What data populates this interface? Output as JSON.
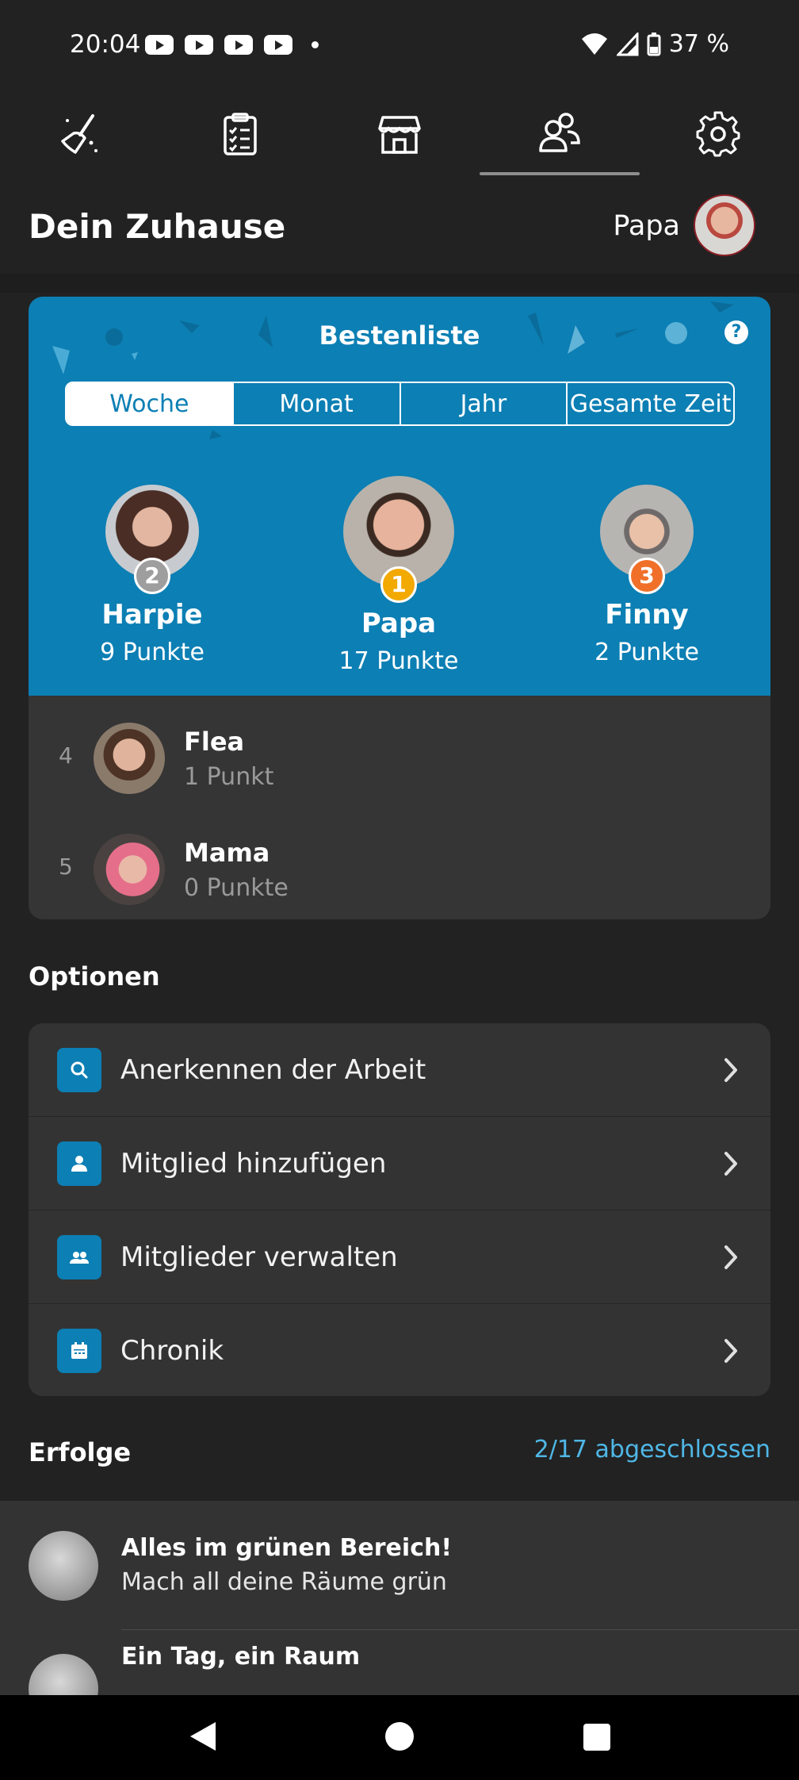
{
  "status_bar": {
    "time": "20:04",
    "battery": "37 %"
  },
  "nav_tabs": [
    {
      "icon": "cleaning-broom-icon"
    },
    {
      "icon": "clipboard-checklist-icon"
    },
    {
      "icon": "shop-icon"
    },
    {
      "icon": "people-icon",
      "active": true
    },
    {
      "icon": "gear-icon"
    }
  ],
  "header": {
    "title": "Dein Zuhause",
    "username": "Papa"
  },
  "leaderboard": {
    "title": "Bestenliste",
    "periods": [
      "Woche",
      "Monat",
      "Jahr",
      "Gesamte Zeit"
    ],
    "active_period": "Woche",
    "podium": [
      {
        "rank": "2",
        "name": "Harpie",
        "points": "9 Punkte",
        "badge_color": "#9e9e9e"
      },
      {
        "rank": "1",
        "name": "Papa",
        "points": "17 Punkte",
        "badge_color": "#f2a900"
      },
      {
        "rank": "3",
        "name": "Finny",
        "points": "2 Punkte",
        "badge_color": "#f0702a"
      }
    ],
    "rows": [
      {
        "rank": "4",
        "name": "Flea",
        "points": "1 Punkt"
      },
      {
        "rank": "5",
        "name": "Mama",
        "points": "0 Punkte"
      }
    ]
  },
  "options": {
    "title": "Optionen",
    "items": [
      {
        "label": "Anerkennen der Arbeit",
        "icon": "search-icon"
      },
      {
        "label": "Mitglied hinzufügen",
        "icon": "person-icon"
      },
      {
        "label": "Mitglieder verwalten",
        "icon": "group-icon"
      },
      {
        "label": "Chronik",
        "icon": "calendar-icon"
      }
    ]
  },
  "achievements": {
    "title": "Erfolge",
    "progress": "2/17 abgeschlossen",
    "items": [
      {
        "title": "Alles im grünen Bereich!",
        "desc": "Mach all deine Räume grün"
      },
      {
        "title": "Ein Tag, ein Raum",
        "desc": ""
      }
    ]
  },
  "colors": {
    "accent": "#0c7fb4",
    "link": "#4fb7e6",
    "background": "#222222",
    "card": "#333333"
  }
}
